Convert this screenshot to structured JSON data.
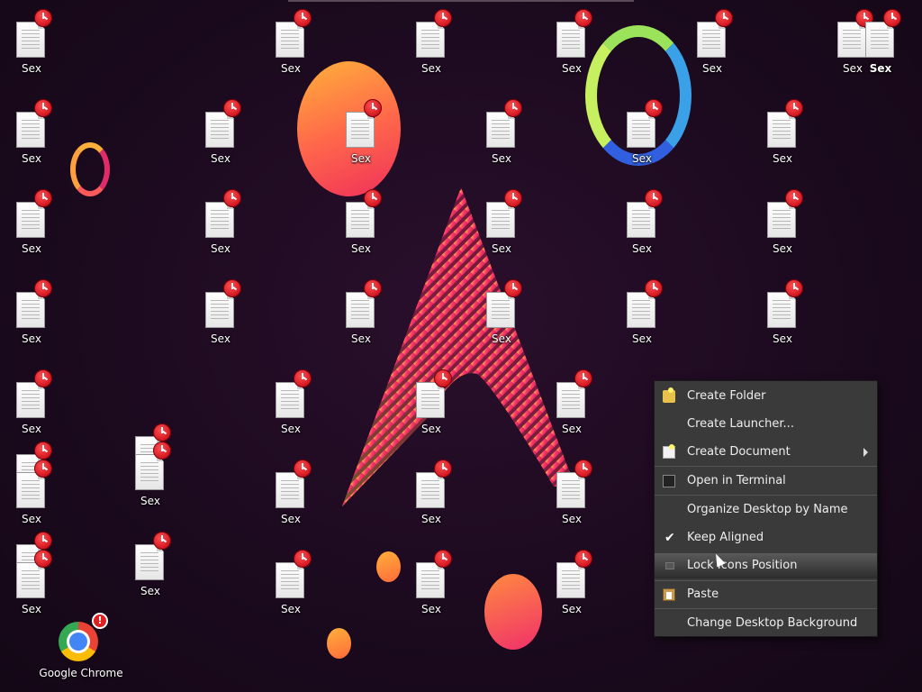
{
  "desktop": {
    "file_label": "Sex",
    "chrome_label": "Google Chrome",
    "chrome_badge": "!"
  },
  "context_menu": {
    "items": [
      {
        "label": "Create Folder"
      },
      {
        "label": "Create Launcher..."
      },
      {
        "label": "Create Document"
      },
      {
        "label": "Open in Terminal"
      },
      {
        "label": "Organize Desktop by Name"
      },
      {
        "label": "Keep Aligned"
      },
      {
        "label": "Lock Icons Position"
      },
      {
        "label": "Paste"
      },
      {
        "label": "Change Desktop Background"
      }
    ]
  }
}
